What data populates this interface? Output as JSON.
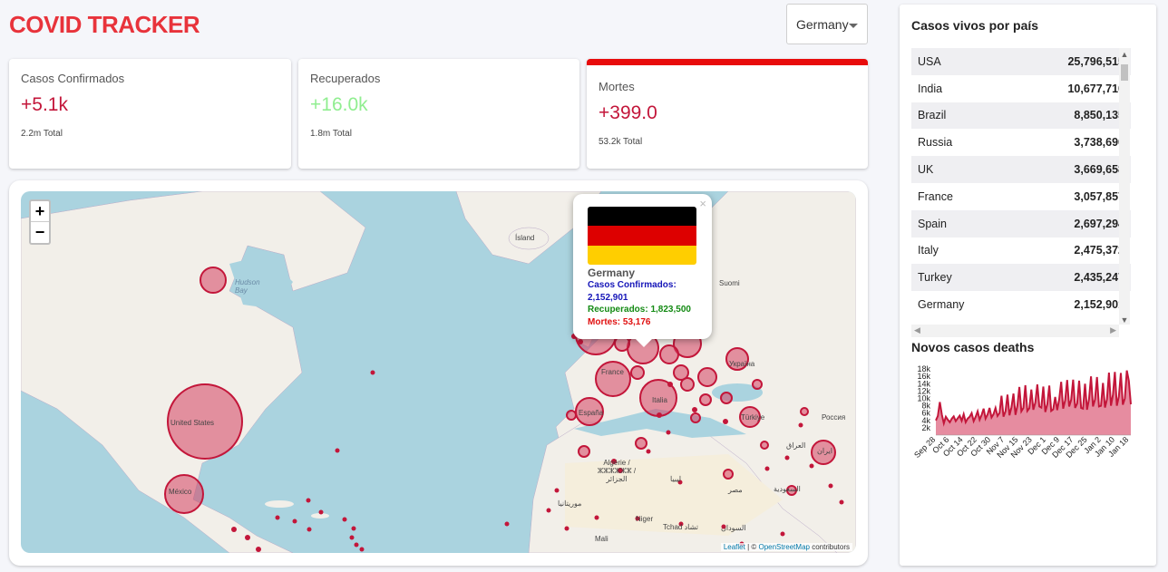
{
  "header": {
    "title": "COVID TRACKER"
  },
  "country_select": {
    "value": "Germany"
  },
  "cards": [
    {
      "title": "Casos Confirmados",
      "value": "+5.1k",
      "total": "2.2m Total",
      "color": "#c3163a"
    },
    {
      "title": "Recuperados",
      "value": "+16.0k",
      "total": "1.8m Total",
      "color": "#90ee90"
    },
    {
      "title": "Mortes",
      "value": "+399.0",
      "total": "53.2k Total",
      "color": "#c3163a"
    }
  ],
  "map": {
    "zoom_in": "+",
    "zoom_out": "−",
    "attribution_leaflet": "Leaflet",
    "attribution_sep": " | © ",
    "attribution_osm": "OpenStreetMap",
    "attribution_rest": " contributors",
    "labels": {
      "islandia": "Ísland",
      "hudson": "Hudson Bay",
      "us": "United States",
      "mexico": "México",
      "france": "France",
      "espana": "España",
      "italia": "Italia",
      "ukraine": "Україна",
      "turkiye": "Türkiye",
      "algerie": "Algérie / ⵣⵣⵣⵣⵣⵣ / الجزائر",
      "libya": "ليبيا",
      "niger": "Niger",
      "tchad": "Tchad تشاد",
      "iraq": "العراق",
      "iran": "ایران",
      "saudi": "السعودية",
      "egypt": "مصر",
      "sudan": "السودان",
      "mauritania": "موريتانيا",
      "mali": "Mali",
      "russia": "Россия",
      "suomi": "Suomi"
    },
    "popup": {
      "country": "Germany",
      "confirmed_label": "Casos Confirmados:",
      "confirmed_value": "2,152,901",
      "recovered_text": "Recuperados: 1,823,500",
      "deaths_text": "Mortes: 53,176",
      "close": "×",
      "flag_colors": [
        "#000000",
        "#dd0000",
        "#ffce00"
      ]
    }
  },
  "sidebar": {
    "title": "Casos vivos por país",
    "rows": [
      {
        "country": "USA",
        "value": "25,796,515"
      },
      {
        "country": "India",
        "value": "10,677,710"
      },
      {
        "country": "Brazil",
        "value": "8,850,135"
      },
      {
        "country": "Russia",
        "value": "3,738,690"
      },
      {
        "country": "UK",
        "value": "3,669,658"
      },
      {
        "country": "France",
        "value": "3,057,857"
      },
      {
        "country": "Spain",
        "value": "2,697,294"
      },
      {
        "country": "Italy",
        "value": "2,475,372"
      },
      {
        "country": "Turkey",
        "value": "2,435,247"
      },
      {
        "country": "Germany",
        "value": "2,152,901"
      }
    ]
  },
  "chart_title": "Novos casos deaths",
  "chart_data": {
    "type": "area",
    "y_ticks": [
      "18k",
      "16k",
      "14k",
      "12k",
      "10k",
      "8k",
      "6k",
      "4k",
      "2k"
    ],
    "ylim": [
      0,
      19000
    ],
    "x_ticks": [
      "Sep 28",
      "Oct 6",
      "Oct 14",
      "Oct 22",
      "Oct 30",
      "Nov 7",
      "Nov 15",
      "Nov 23",
      "Dec 1",
      "Dec 9",
      "Dec 17",
      "Dec 25",
      "Jan 2",
      "Jan 10",
      "Jan 18"
    ],
    "values": [
      4000,
      5200,
      9000,
      5600,
      3200,
      5000,
      4200,
      3500,
      4500,
      5100,
      3800,
      4600,
      5300,
      3900,
      5700,
      3500,
      4500,
      5000,
      6000,
      3800,
      5000,
      6500,
      4200,
      5500,
      7200,
      4500,
      5600,
      7400,
      4800,
      5700,
      7400,
      5200,
      6000,
      10700,
      5000,
      6500,
      11000,
      5400,
      7600,
      11300,
      5500,
      8000,
      13100,
      6500,
      7400,
      13600,
      6600,
      7300,
      12400,
      6900,
      8900,
      13800,
      7800,
      7500,
      13200,
      6300,
      8400,
      13500,
      6600,
      7000,
      10400,
      6800,
      9700,
      14500,
      7200,
      9500,
      15000,
      7800,
      9600,
      15100,
      7400,
      8600,
      14800,
      7400,
      7200,
      14000,
      6900,
      9800,
      16000,
      7800,
      9700,
      15800,
      7800,
      8000,
      14200,
      7500,
      9800,
      17000,
      8000,
      11000,
      17200,
      8000,
      10500,
      16900,
      8300,
      10000,
      17600,
      14800,
      8400
    ],
    "color": "#c3163a"
  }
}
